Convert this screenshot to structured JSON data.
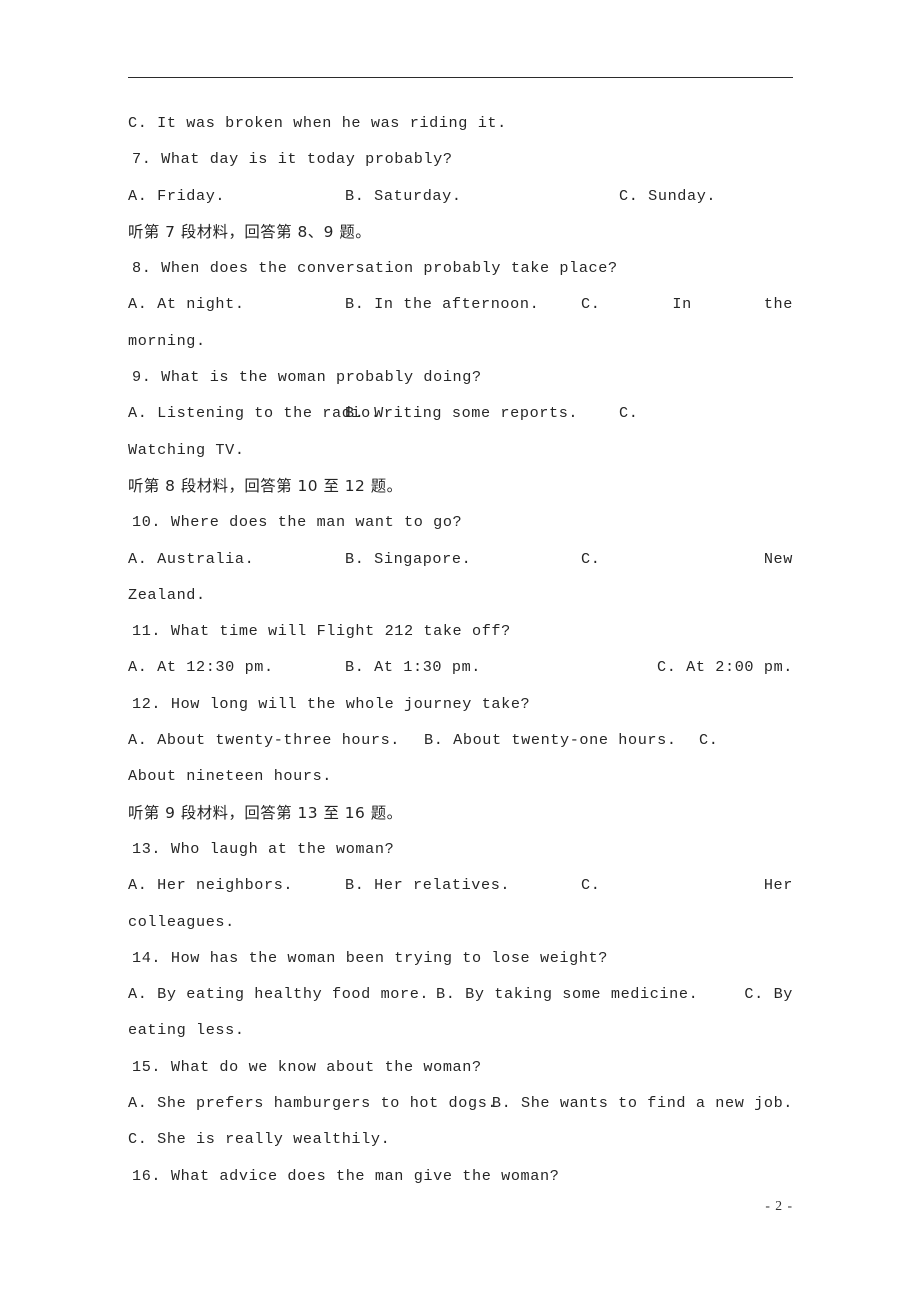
{
  "document": {
    "page_footer": "- 2 -"
  },
  "blocks": [
    {
      "kind": "option_single",
      "name": "option-c-q6",
      "text": "C. It was broken when he was riding it."
    },
    {
      "kind": "question",
      "name": "question-7",
      "text": "7. What day is it today probably?"
    },
    {
      "kind": "option_row",
      "name": "options-q7",
      "a": "A. Friday.",
      "b": "B. Saturday.",
      "c": "C. Sunday."
    },
    {
      "kind": "chinese",
      "name": "listening-instruction-7",
      "text": "听第 7 段材料，回答第 8、9 题。"
    },
    {
      "kind": "question",
      "name": "question-8",
      "text": "8. When does the conversation probably take place?"
    },
    {
      "kind": "option_row_wrapped",
      "name": "options-q8",
      "a": "A. At night.",
      "b": "B. In the afternoon.",
      "c_head": "C.",
      "c_mid": "In",
      "c_tail": "the",
      "continuation": "morning."
    },
    {
      "kind": "question",
      "name": "question-9",
      "text": "9. What is the woman probably doing?"
    },
    {
      "kind": "option_row_wrapped_simple",
      "name": "options-q9",
      "a": "A. Listening to the radio.",
      "b": "B. Writing some reports.",
      "c": "C.",
      "continuation": "Watching TV."
    },
    {
      "kind": "chinese",
      "name": "listening-instruction-8",
      "text": "听第 8 段材料，回答第 10 至 12 题。"
    },
    {
      "kind": "question",
      "name": "question-10",
      "text": "10. Where does the man want to go?"
    },
    {
      "kind": "option_row_wrapped",
      "name": "options-q10",
      "a": "A. Australia.",
      "b": "B. Singapore.",
      "c_head": "C.",
      "c_mid": "",
      "c_tail": "New",
      "continuation": "Zealand."
    },
    {
      "kind": "question",
      "name": "question-11",
      "text": "11. What time will Flight 212 take off?"
    },
    {
      "kind": "option_row",
      "name": "options-q11",
      "a": "A. At 12:30 pm.",
      "b": "B. At 1:30 pm.",
      "c": "C. At 2:00 pm."
    },
    {
      "kind": "question",
      "name": "question-12",
      "text": "12. How long will the whole journey take?"
    },
    {
      "kind": "option_row_wrapped_simple",
      "name": "options-q12",
      "a": "A. About twenty-three hours.",
      "b": "B. About twenty-one hours.",
      "c": "C.",
      "continuation": "About nineteen hours."
    },
    {
      "kind": "chinese",
      "name": "listening-instruction-9",
      "text": "听第 9 段材料，回答第 13 至 16 题。"
    },
    {
      "kind": "question",
      "name": "question-13",
      "text": "13. Who laugh at the woman?"
    },
    {
      "kind": "option_row_wrapped",
      "name": "options-q13",
      "a": "A. Her neighbors.",
      "b": "B. Her relatives.",
      "c_head": "C.",
      "c_mid": "",
      "c_tail": "Her",
      "continuation": "colleagues."
    },
    {
      "kind": "question",
      "name": "question-14",
      "text": "14. How has the woman been trying to lose weight?"
    },
    {
      "kind": "option_row_wrapped_simple",
      "name": "options-q14",
      "a": "A. By eating healthy food more.",
      "b": "B. By taking some medicine.",
      "c": "C. By",
      "continuation": "eating less."
    },
    {
      "kind": "question",
      "name": "question-15",
      "text": "15. What do we know about the woman?"
    },
    {
      "kind": "option_two_col",
      "name": "options-q15-ab",
      "a": "A. She prefers hamburgers to hot dogs.",
      "b": "B. She wants to find a new job."
    },
    {
      "kind": "option_single",
      "name": "option-c-q15",
      "text": "C. She is really wealthily."
    },
    {
      "kind": "question",
      "name": "question-16",
      "text": "16. What advice does the man give the woman?"
    }
  ]
}
